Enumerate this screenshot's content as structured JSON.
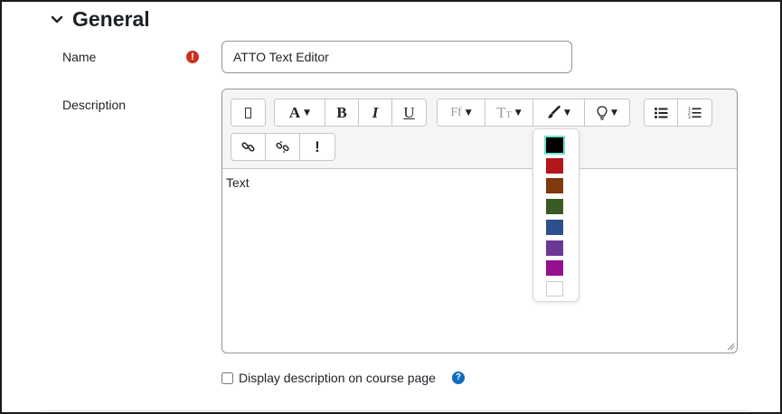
{
  "section": {
    "title": "General",
    "chevron_icon": "chevron-down-icon"
  },
  "fields": {
    "name_label": "Name",
    "name_required_icon": "exclamation-circle-icon",
    "name_required_color": "#ca3120",
    "name_value": "ATTO Text Editor",
    "description_label": "Description"
  },
  "toolbar": {
    "collapse_icon": "toolbar-collapse-icon",
    "font_style_label": "A",
    "bold_label": "B",
    "italic_label": "I",
    "underline_label": "U",
    "font_family_label": "Ff",
    "font_size_label": "T",
    "font_size_sub": "T",
    "font_color_icon": "paintbrush-icon",
    "background_color_icon": "lightbulb-icon",
    "unordered_list_icon": "bulleted-list-icon",
    "ordered_list_icon": "numbered-list-icon",
    "link_icon": "link-icon",
    "unlink_icon": "unlink-icon",
    "accessibility_label": "!"
  },
  "editor": {
    "content": "Text"
  },
  "color_menu": {
    "colors": [
      "#000000",
      "#b5161c",
      "#7f3a0f",
      "#3b5b25",
      "#2e4f8e",
      "#6c3795",
      "#93108f",
      "#ffffff"
    ],
    "selected": "#000000",
    "selected_outline": "#6fe3d0"
  },
  "display_checkbox": {
    "label": "Display description on course page",
    "checked": false,
    "help_icon": "question-circle-icon",
    "help_color": "#0f6cbf"
  }
}
